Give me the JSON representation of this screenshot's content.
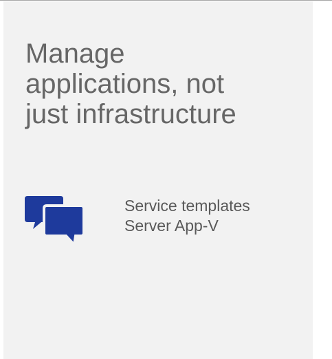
{
  "headline": {
    "lines": [
      "Manage",
      "applications, not",
      "just infrastructure"
    ]
  },
  "feature_icon": {
    "name": "chat-bubbles-icon",
    "color": "#1e3a9c"
  },
  "features": {
    "items": [
      "Service templates",
      "Server App-V"
    ]
  },
  "colors": {
    "panel_background": "#f2f2f2",
    "headline_text": "#666666",
    "body_text": "#595959",
    "accent": "#1e3a9c"
  }
}
